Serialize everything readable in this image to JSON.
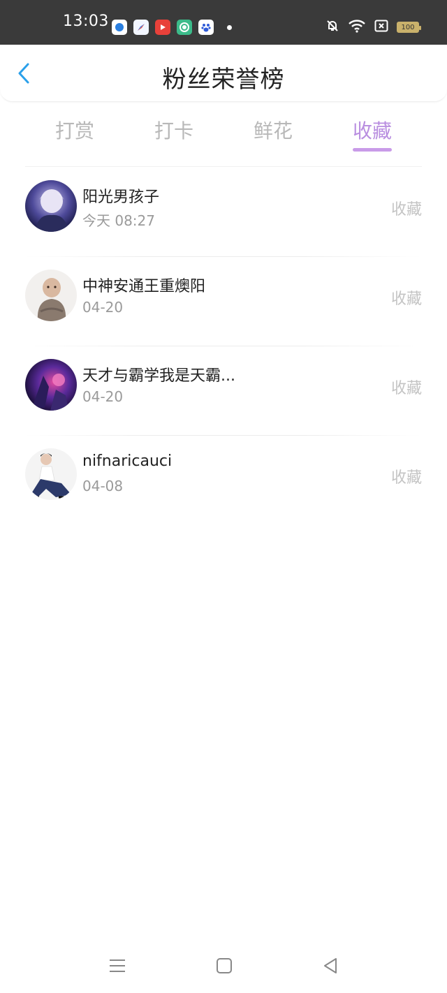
{
  "status_bar": {
    "time": "13:03",
    "battery": "100",
    "icons": [
      "notification-app-icon",
      "compass-app-icon",
      "video-app-icon",
      "sync-app-icon",
      "baidu-app-icon",
      "bell-muted-icon",
      "wifi-icon",
      "sim-icon",
      "battery-icon"
    ]
  },
  "header": {
    "title": "粉丝荣誉榜",
    "back_icon": "chevron-left-icon"
  },
  "tabs": [
    {
      "label": "打赏"
    },
    {
      "label": "打卡"
    },
    {
      "label": "鲜花"
    },
    {
      "label": "收藏"
    }
  ],
  "active_tab": "收藏",
  "colors": {
    "accent": "#b98ee0",
    "underline": "#c99be8",
    "back_icon": "#2aa0ea",
    "status_bar": "#3a3a3a"
  },
  "fans": [
    {
      "name": "阳光男孩子",
      "date": "今天 08:27",
      "type": "收藏"
    },
    {
      "name": "中神安通王重燠阳",
      "date": "04-20",
      "type": "收藏"
    },
    {
      "name": "天才与霸学我是天霸...",
      "date": "04-20",
      "type": "收藏"
    },
    {
      "name": "nifnaricauci",
      "date": "04-08",
      "type": "收藏"
    }
  ],
  "nav": {
    "menu_icon": "menu-icon",
    "home_icon": "home-square-icon",
    "back_icon": "back-triangle-icon"
  }
}
